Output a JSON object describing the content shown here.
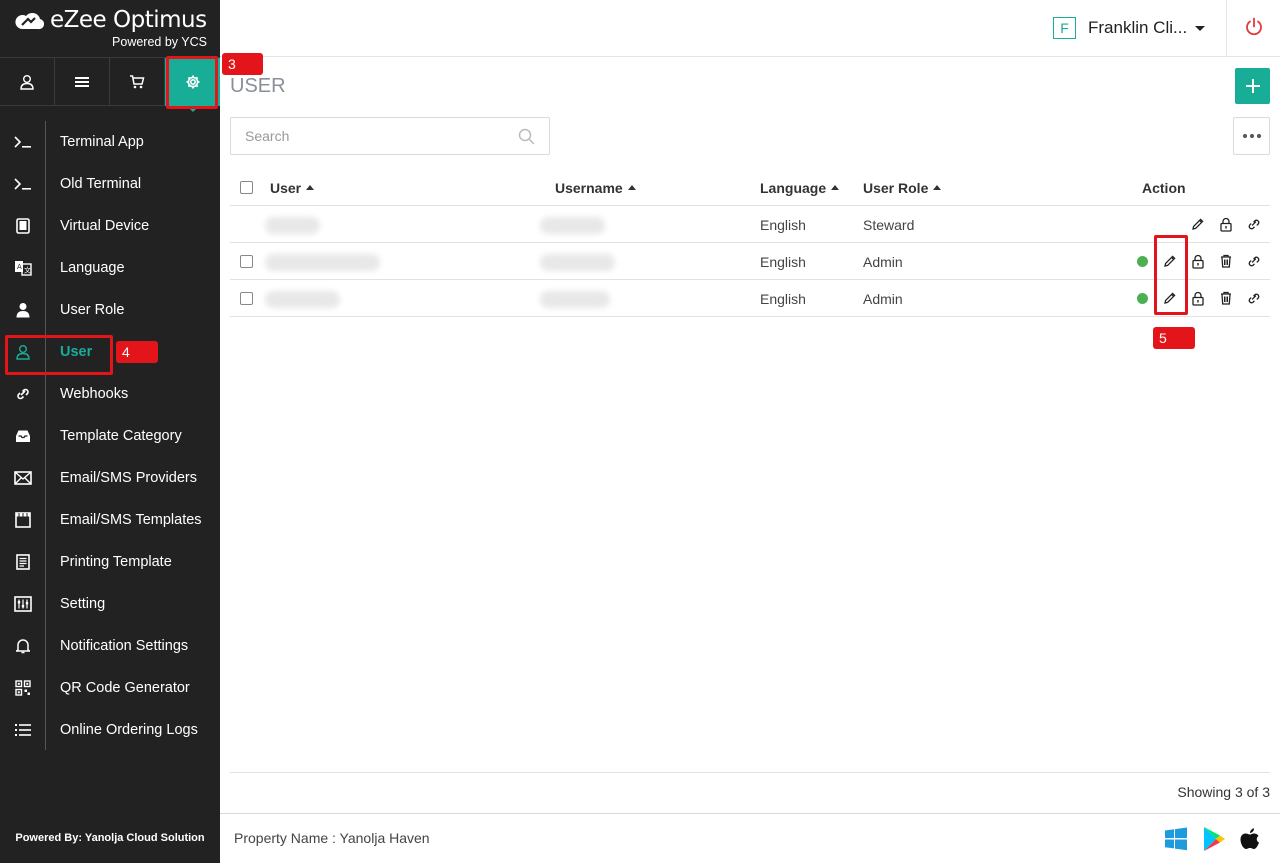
{
  "brand": {
    "name": "eZee Optimus",
    "tagline": "Powered by YCS"
  },
  "top_nav": [
    {
      "icon": "user-icon"
    },
    {
      "icon": "menu-icon"
    },
    {
      "icon": "cart-icon"
    },
    {
      "icon": "gear-icon",
      "active": true
    }
  ],
  "sidebar": {
    "items": [
      {
        "label": "Terminal App",
        "icon": "terminal-icon"
      },
      {
        "label": "Old Terminal",
        "icon": "terminal-icon"
      },
      {
        "label": "Virtual Device",
        "icon": "tablet-icon"
      },
      {
        "label": "Language",
        "icon": "translate-icon"
      },
      {
        "label": "User Role",
        "icon": "user-role-icon"
      },
      {
        "label": "User",
        "icon": "user-icon",
        "active": true
      },
      {
        "label": "Webhooks",
        "icon": "link-icon"
      },
      {
        "label": "Template Category",
        "icon": "inbox-icon"
      },
      {
        "label": "Email/SMS Providers",
        "icon": "mail-icon"
      },
      {
        "label": "Email/SMS Templates",
        "icon": "film-icon"
      },
      {
        "label": "Printing Template",
        "icon": "receipt-icon"
      },
      {
        "label": "Setting",
        "icon": "sliders-icon"
      },
      {
        "label": "Notification Settings",
        "icon": "bell-icon"
      },
      {
        "label": "QR Code Generator",
        "icon": "qr-icon"
      },
      {
        "label": "Online Ordering Logs",
        "icon": "list-icon"
      }
    ],
    "footer": "Powered By: Yanolja Cloud Solution"
  },
  "header": {
    "property_initial": "F",
    "property_name": "Franklin Cli...",
    "power_icon": "power-icon"
  },
  "page": {
    "title": "USER",
    "search_placeholder": "Search"
  },
  "table": {
    "columns": [
      "User",
      "Username",
      "Language",
      "User Role",
      "Action"
    ],
    "rows": [
      {
        "user": "",
        "username": "",
        "language": "English",
        "role": "Steward",
        "has_checkbox": false,
        "active_dot": false,
        "actions": [
          "edit",
          "lock",
          "link"
        ]
      },
      {
        "user": "",
        "username": "",
        "language": "English",
        "role": "Admin",
        "has_checkbox": true,
        "active_dot": true,
        "actions": [
          "edit",
          "lock",
          "delete",
          "link"
        ]
      },
      {
        "user": "",
        "username": "",
        "language": "English",
        "role": "Admin",
        "has_checkbox": true,
        "active_dot": true,
        "actions": [
          "edit",
          "lock",
          "delete",
          "link"
        ]
      }
    ],
    "showing": "Showing 3 of 3"
  },
  "footer": {
    "property_name": "Property Name : Yanolja Haven",
    "stores": [
      "windows-icon",
      "google-play-icon",
      "apple-icon"
    ]
  },
  "annotations": {
    "step3": "3",
    "step4": "4",
    "step5": "5",
    "color": "#e3141a"
  },
  "colors": {
    "accent": "#18ad97",
    "sidebar_bg": "#222222",
    "status_active": "#4caf50"
  }
}
